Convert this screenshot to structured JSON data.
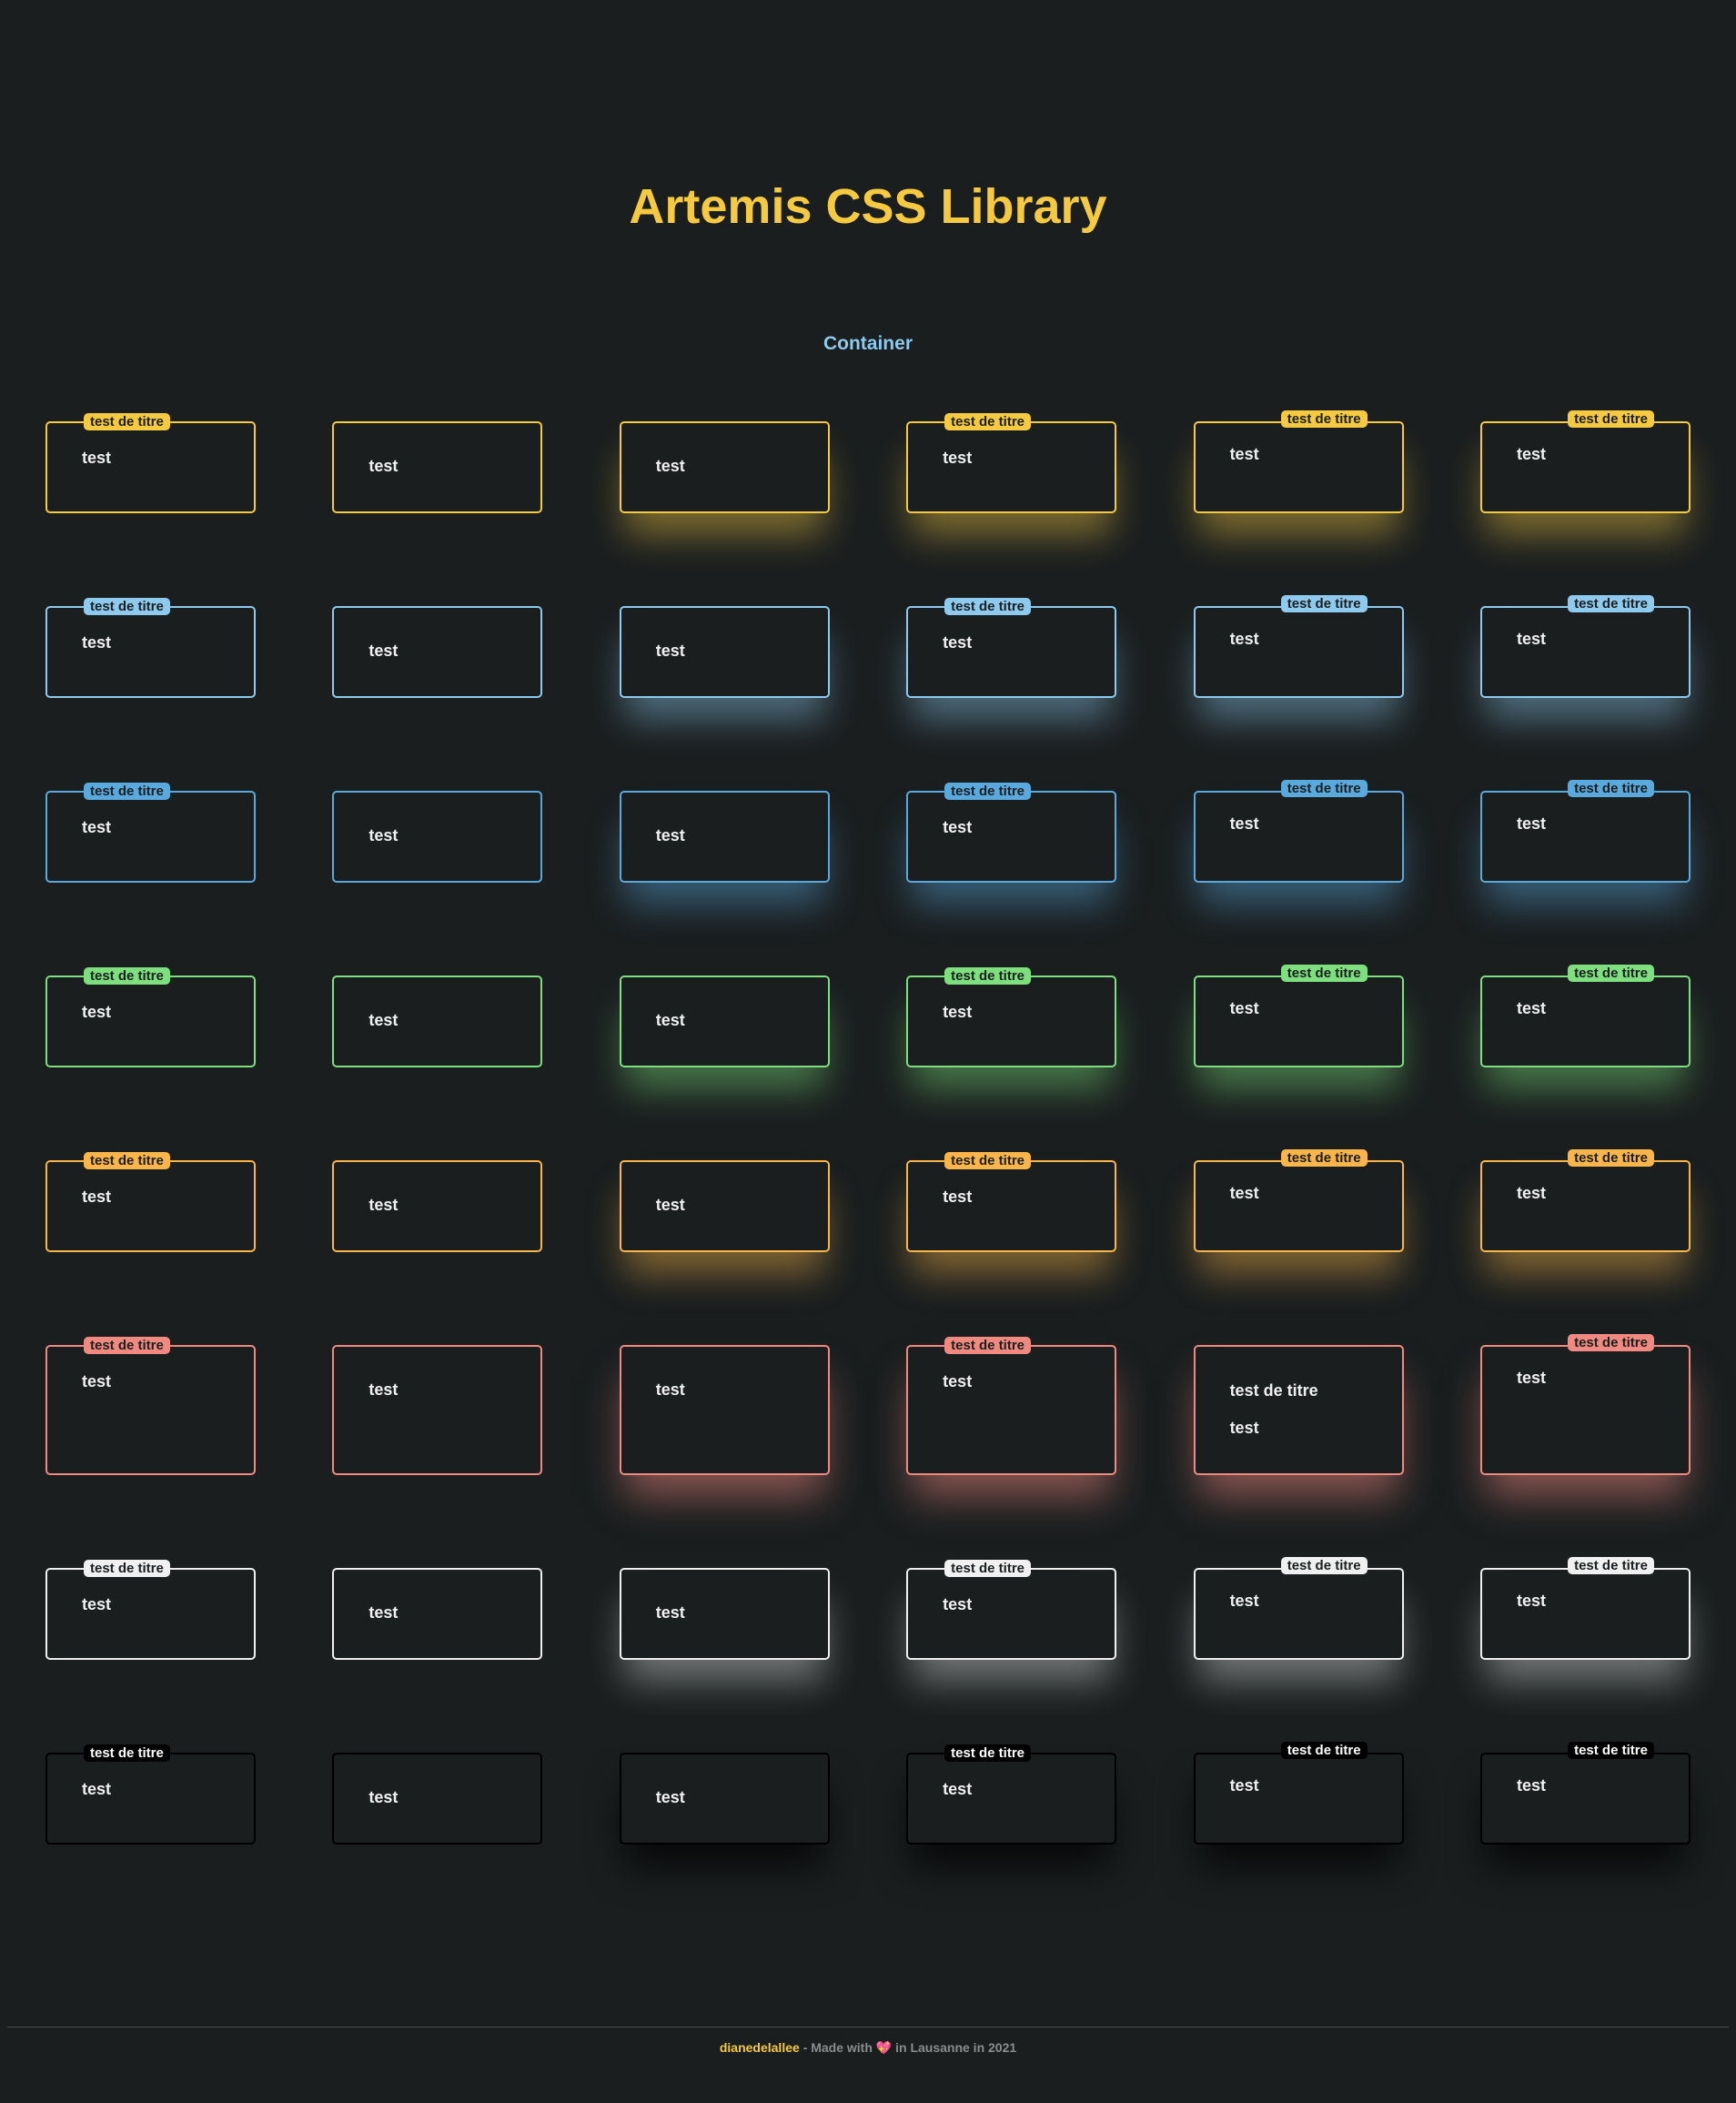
{
  "title": "Artemis CSS Library",
  "section": "Container",
  "rows": [
    {
      "color": "#f5c940",
      "badge_text_color": "#1a1e1f",
      "glow": "rgba(245,201,64,0.45)"
    },
    {
      "color": "#8ec9ee",
      "badge_text_color": "#1a1e1f",
      "glow": "rgba(142,201,238,0.45)"
    },
    {
      "color": "#5aa9dd",
      "badge_text_color": "#1a1e1f",
      "glow": "rgba(90,169,221,0.45)"
    },
    {
      "color": "#7ddf7d",
      "badge_text_color": "#1a1e1f",
      "glow": "rgba(125,223,125,0.45)"
    },
    {
      "color": "#f9b54a",
      "badge_text_color": "#1a1e1f",
      "glow": "rgba(249,181,74,0.45)"
    },
    {
      "color": "#f08a80",
      "badge_text_color": "#1a1e1f",
      "glow": "rgba(240,138,128,0.5)"
    },
    {
      "color": "#f0f0f0",
      "badge_text_color": "#1a1e1f",
      "glow": "rgba(240,240,240,0.4)"
    },
    {
      "color": "#000000",
      "badge_text_color": "#ffffff",
      "glow": "rgba(0,0,0,0.7)"
    }
  ],
  "badge_label": "test de titre",
  "content_label": "test",
  "special_title": "test de titre",
  "footer": {
    "author": "dianedelallee",
    "separator": " - Made with ",
    "heart": "💖",
    "rest": " in Lausanne in 2021"
  }
}
